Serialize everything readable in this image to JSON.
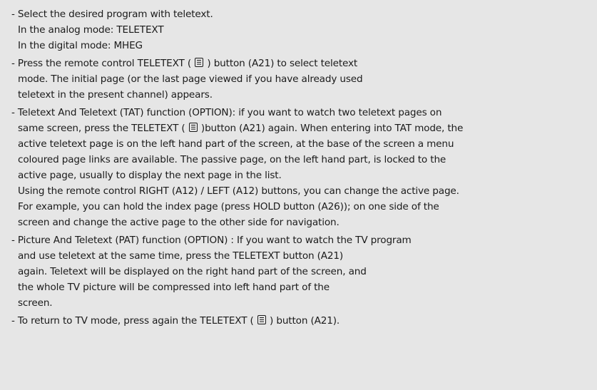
{
  "icons": {
    "teletext": "teletext-button-icon"
  },
  "items": [
    {
      "lines": [
        "- Select the desired program with teletext.",
        "In the analog mode: TELETEXT",
        "In the digital mode: MHEG"
      ]
    },
    {
      "l1a": "- Press the remote control TELETEXT (",
      "l1b": ") button (A21) to select teletext",
      "l2": "mode. The initial page (or the last page viewed if you have already used",
      "l3": "teletext in the present channel) appears."
    },
    {
      "l1": "- Teletext And Teletext (TAT) function (OPTION): if you want to watch two teletext pages on",
      "l2a": "same screen, press the TELETEXT (",
      "l2b": ")button (A21) again. When entering into TAT mode, the",
      "lines": [
        "active teletext page is on the left hand part of the screen, at the base of the screen a menu",
        "coloured page links are available. The passive page, on the left hand part, is locked to the",
        "active page, usually to display the next page in the list.",
        "Using the remote control RIGHT (A12) / LEFT (A12) buttons, you can change the active page.",
        "For example, you can hold the index page (press HOLD button (A26)); on one side of the",
        "screen and change the active page to the other side for navigation."
      ]
    },
    {
      "lines": [
        "- Picture And Teletext (PAT) function (OPTION) : If you want to watch the TV program",
        "and use teletext at the same time, press the TELETEXT button (A21)",
        "again. Teletext will be displayed on the right hand part of the screen, and",
        "the whole TV picture will be compressed into left hand part of the",
        "screen."
      ]
    },
    {
      "l1a": "- To return to TV mode, press again the TELETEXT (",
      "l1b": ") button (A21)."
    }
  ]
}
